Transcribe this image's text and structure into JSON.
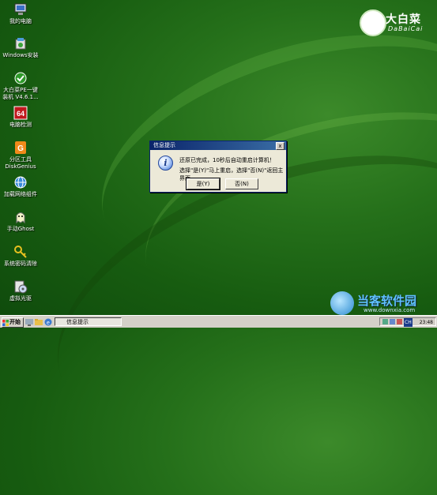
{
  "desktop": {
    "icons": [
      {
        "label": "我的电脑",
        "icon": "computer-icon"
      },
      {
        "label": "Windows安装",
        "icon": "installer-icon"
      },
      {
        "label": "大白菜PE一键\n装机 V4.6.1...",
        "icon": "onekey-install-icon"
      },
      {
        "label": "电脑检测",
        "icon": "pc-check-icon"
      },
      {
        "label": "分区工具\nDiskGenius",
        "icon": "diskgenius-icon"
      },
      {
        "label": "加载网络组件",
        "icon": "network-icon"
      },
      {
        "label": "手动Ghost",
        "icon": "ghost-icon"
      },
      {
        "label": "系统密码清除",
        "icon": "key-icon"
      },
      {
        "label": "虚拟光驱",
        "icon": "virtual-drive-icon"
      }
    ],
    "logo": {
      "cn": "大白菜",
      "en": "DaBaiCai"
    }
  },
  "dialog": {
    "title": "信息提示",
    "close_label": "x",
    "line1": "还原已完成，10秒后自动重启计算机！",
    "line2": "选择\"是(Y)\"马上重启，选择\"否(N)\"返回主界面。",
    "yes_label": "是(Y)",
    "no_label": "否(N)"
  },
  "taskbar": {
    "start_label": "开始",
    "task_label": "信息提示",
    "clock": "23:48",
    "tray_text": "CH"
  },
  "watermark": {
    "title": "当客软件园",
    "url": "www.downxia.com"
  }
}
